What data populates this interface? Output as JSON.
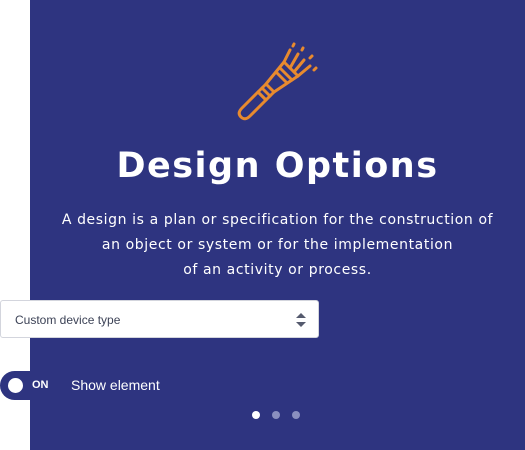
{
  "slide": {
    "title": "Design Options",
    "description_lines": [
      "A design is a plan or specification for the construction of",
      "an object or system or for the implementation",
      "of an activity or process."
    ],
    "icon": "paintbrush-icon",
    "background_color": "#2e3480",
    "accent_color": "#e88a2e"
  },
  "device_select": {
    "value": "Custom device type",
    "icon": "sort-arrows-icon"
  },
  "toggle": {
    "state_text": "ON",
    "label": "Show element",
    "on": true
  },
  "pagination": {
    "total": 3,
    "active_index": 0
  }
}
